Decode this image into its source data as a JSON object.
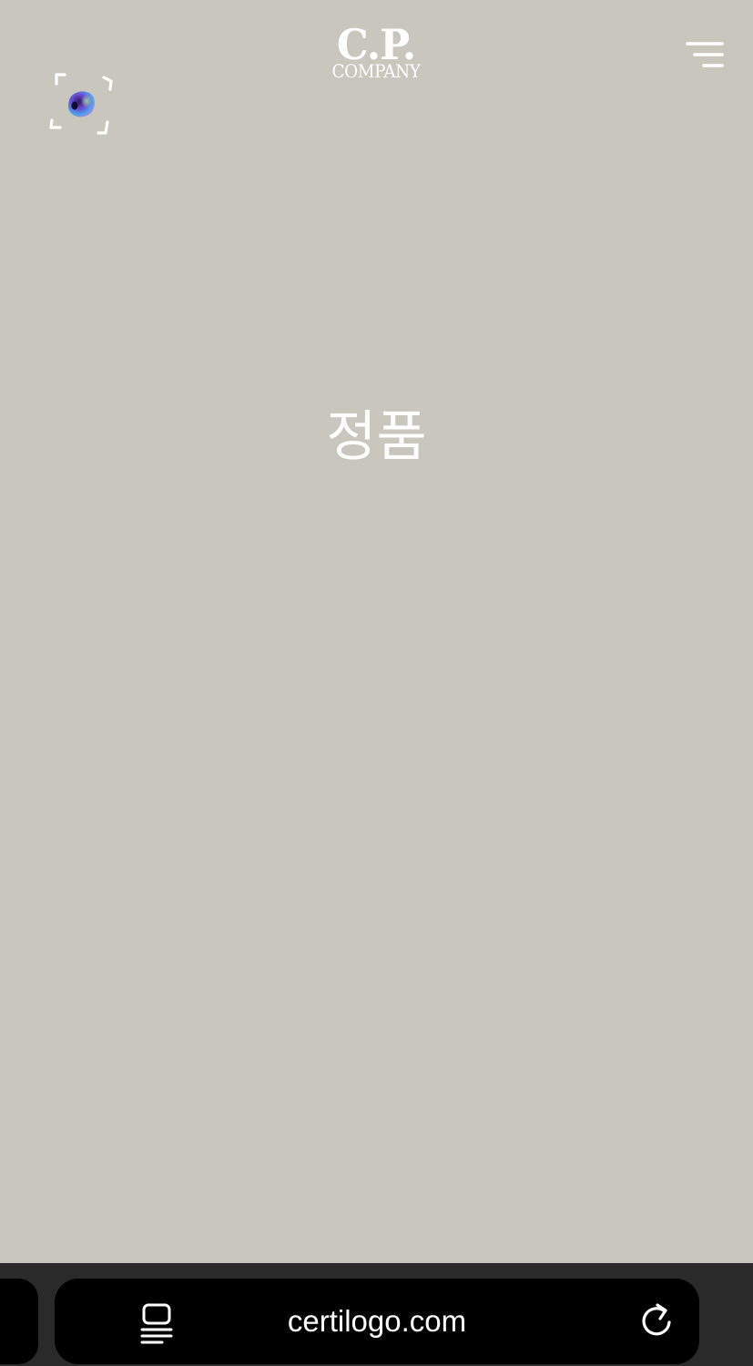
{
  "header": {
    "logo_main": "C.P.",
    "logo_sub": "COMPANY",
    "menu_icon": "hamburger-menu-icon",
    "scan_icon": "scan-viewfinder-icon"
  },
  "main": {
    "headline": "정품"
  },
  "browser": {
    "url": "certilogo.com",
    "reader_icon": "page-menu-icon",
    "reload_icon": "reload-icon"
  },
  "colors": {
    "page_background": "#c9c6be",
    "toolbar_background": "#2a2a2a",
    "pill_background": "#000000",
    "foreground": "#ffffff"
  }
}
